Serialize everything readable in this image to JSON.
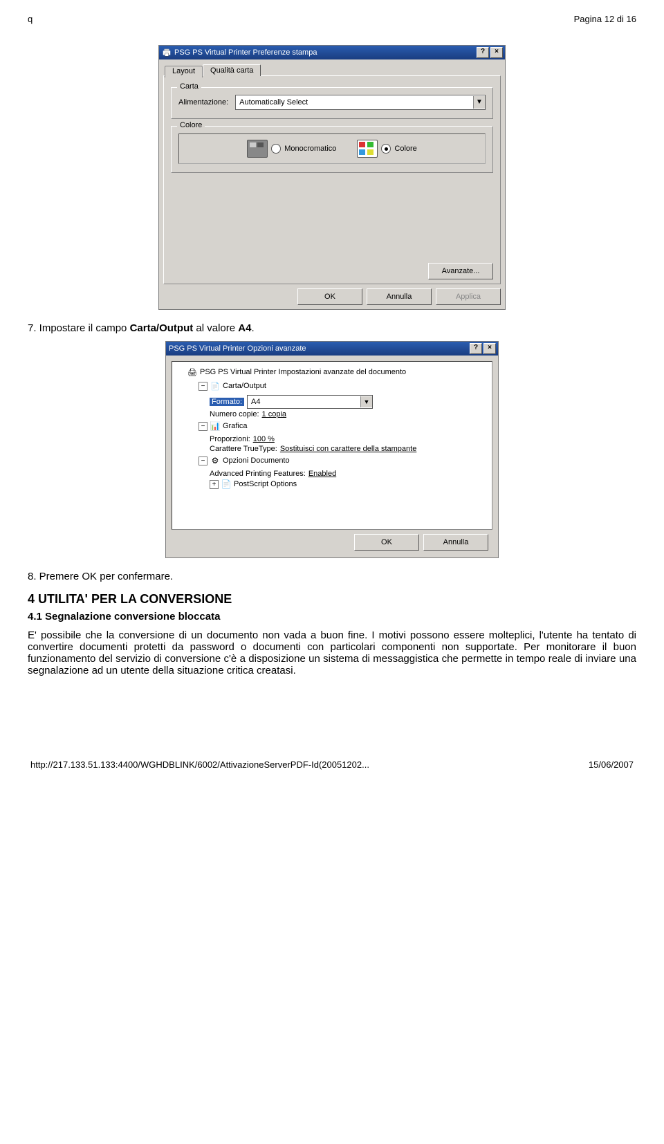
{
  "header": {
    "left": "q",
    "right": "Pagina 12 di 16"
  },
  "dialog1": {
    "title": "PSG PS Virtual Printer Preferenze stampa",
    "tabs": {
      "layout": "Layout",
      "quality": "Qualità carta"
    },
    "group_carta": {
      "legend": "Carta",
      "label": "Alimentazione:",
      "value": "Automatically Select"
    },
    "group_colore": {
      "legend": "Colore",
      "mono": "Monocromatico",
      "color": "Colore"
    },
    "advanced_btn": "Avanzate...",
    "ok": "OK",
    "cancel": "Annulla",
    "apply": "Applica"
  },
  "doc": {
    "step7_prefix": "7. Impostare il campo ",
    "step7_bold": "Carta/Output",
    "step7_suffix": " al valore ",
    "step7_bold2": "A4",
    "step7_end": ".",
    "step8": "8. Premere OK per confermare.",
    "h1": "4  UTILITA' PER LA CONVERSIONE",
    "h2": "4.1 Segnalazione conversione bloccata",
    "para": "E' possibile che la conversione di un documento non vada a buon fine. I motivi possono essere molteplici, l'utente ha tentato di convertire documenti protetti da password o documenti con particolari componenti non supportate. Per monitorare il buon funzionamento del servizio di conversione c'è a disposizione un sistema di messaggistica che permette in tempo reale di inviare una segnalazione ad un utente della situazione critica creatasi."
  },
  "dialog2": {
    "title": "PSG PS Virtual Printer Opzioni avanzate",
    "tree": {
      "root": "PSG PS Virtual Printer Impostazioni avanzate del documento",
      "n1": "Carta/Output",
      "n1a_label": "Formato:",
      "n1a_value": "A4",
      "n1b": "Numero copie:",
      "n1b_val": "1 copia",
      "n2": "Grafica",
      "n2a": "Proporzioni:",
      "n2a_val": "100 %",
      "n2b": "Carattere TrueType:",
      "n2b_val": "Sostituisci con carattere della stampante",
      "n3": "Opzioni Documento",
      "n3a": "Advanced Printing Features:",
      "n3a_val": "Enabled",
      "n3b": "PostScript Options"
    },
    "ok": "OK",
    "cancel": "Annulla"
  },
  "footer": {
    "url": "http://217.133.51.133:4400/WGHDBLINK/6002/AttivazioneServerPDF-Id(20051202...",
    "date": "15/06/2007"
  }
}
